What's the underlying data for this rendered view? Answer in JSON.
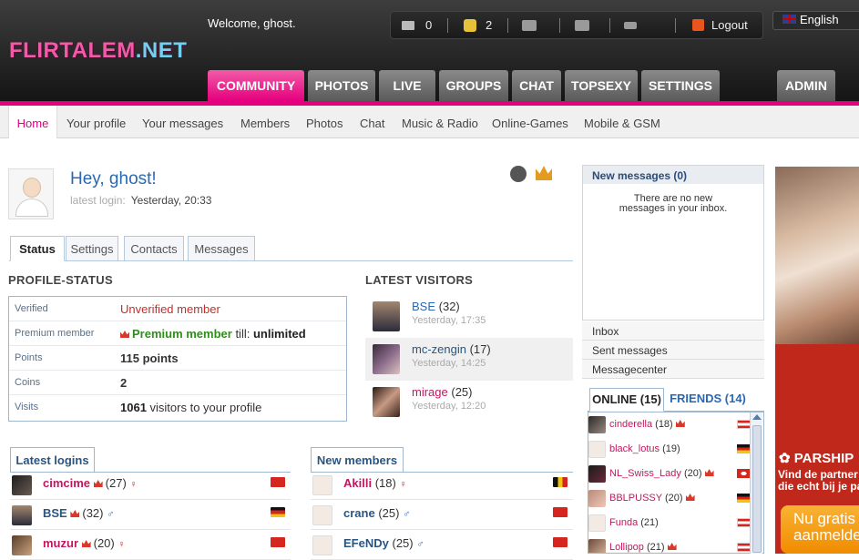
{
  "header": {
    "logo_main": "FLIRTALEM",
    "logo_tld": ".NET",
    "welcome": "Welcome, ghost.",
    "toolbar": {
      "messages_count": "0",
      "coins_count": "2",
      "logout_label": "Logout"
    },
    "language": "English",
    "main_tabs": [
      "COMMUNITY",
      "PHOTOS",
      "LIVE",
      "GROUPS",
      "CHAT",
      "TOPSEXY",
      "SETTINGS",
      "ADMIN"
    ]
  },
  "subnav": [
    "Home",
    "Your profile",
    "Your messages",
    "Members",
    "Photos",
    "Chat",
    "Music & Radio",
    "Online-Games",
    "Mobile & GSM"
  ],
  "profile": {
    "greeting": "Hey, ghost!",
    "last_login_label": "latest login:",
    "last_login_value": "Yesterday, 20:33"
  },
  "section_tabs": [
    "Status",
    "Settings",
    "Contacts",
    "Messages"
  ],
  "profile_status": {
    "title": "PROFILE-STATUS",
    "rows": [
      {
        "label": "Verified",
        "value": "Unverified member"
      },
      {
        "label": "Premium member",
        "value_main": "Premium member",
        "value_mid": " till: ",
        "value_end": "unlimited"
      },
      {
        "label": "Points",
        "value": "115 points"
      },
      {
        "label": "Coins",
        "value": "2"
      },
      {
        "label": "Visits",
        "value_bold": "1061",
        "value_rest": " visitors to your profile"
      }
    ]
  },
  "latest_visitors": {
    "title": "LATEST VISITORS",
    "items": [
      {
        "name": "BSE",
        "age": "(32)",
        "time": "Yesterday, 17:35"
      },
      {
        "name": "mc-zengin",
        "age": "(17)",
        "time": "Yesterday, 14:25"
      },
      {
        "name": "mirage",
        "age": "(25)",
        "time": "Yesterday, 12:20"
      }
    ]
  },
  "latest_logins": {
    "title": "Latest logins",
    "items": [
      {
        "name": "cimcime",
        "age": "(27)",
        "gender": "♀"
      },
      {
        "name": "BSE",
        "age": "(32)",
        "gender": "♂"
      },
      {
        "name": "muzur",
        "age": "(20)",
        "gender": "♀"
      }
    ]
  },
  "new_members": {
    "title": "New members",
    "items": [
      {
        "name": "Akilli",
        "age": "(18)",
        "gender": "♀"
      },
      {
        "name": "crane",
        "age": "(25)",
        "gender": "♂"
      },
      {
        "name": "EFeNDy",
        "age": "(25)",
        "gender": "♂"
      }
    ]
  },
  "messages_panel": {
    "title": "New messages (0)",
    "empty_text_1": "There are no new",
    "empty_text_2": "messages in your inbox.",
    "links": [
      "Inbox",
      "Sent messages",
      "Messagecenter"
    ]
  },
  "online_panel": {
    "tab_online": "ONLINE (15)",
    "tab_friends": "FRIENDS (14)",
    "items": [
      {
        "name": "cinderella",
        "age": "(18)"
      },
      {
        "name": "black_lotus",
        "age": "(19)"
      },
      {
        "name": "NL_Swiss_Lady",
        "age": "(20)"
      },
      {
        "name": "BBLPUSSY",
        "age": "(20)"
      },
      {
        "name": "Funda",
        "age": "(21)"
      },
      {
        "name": "Lollipop",
        "age": "(21)"
      }
    ]
  },
  "ad": {
    "brand": "PARSHIP",
    "line1": "Vind de partner",
    "line2": "die echt bij je past",
    "button1": "Nu gratis",
    "button2": "aanmelden"
  }
}
